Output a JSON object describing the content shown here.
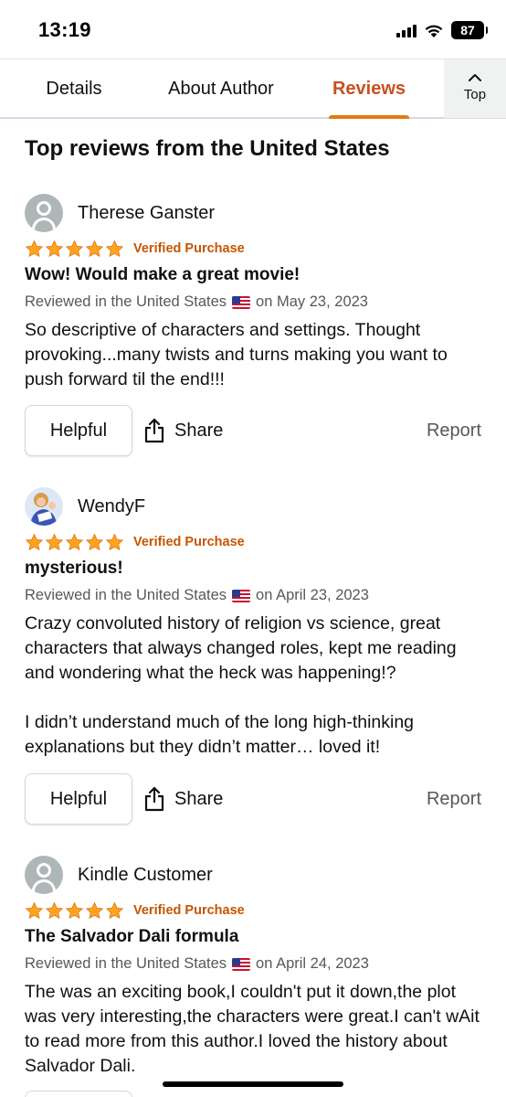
{
  "status_bar": {
    "time": "13:19",
    "battery": "87",
    "icons": [
      "signal-icon",
      "wifi-icon",
      "battery-icon"
    ]
  },
  "tabs": [
    {
      "label": "Details",
      "active": false
    },
    {
      "label": "About Author",
      "active": false
    },
    {
      "label": "Reviews",
      "active": true
    }
  ],
  "top_button": {
    "label": "Top",
    "icon": "chevron-up-icon"
  },
  "section_title": "Top reviews from the United States",
  "reviews": [
    {
      "name": "Therese Ganster",
      "rating": 5,
      "verified": "Verified Purchase",
      "title": "Wow! Would make a great movie!",
      "meta_prefix": "Reviewed in the United States",
      "meta_date": "on May 23, 2023",
      "body": [
        "So descriptive of characters and settings. Thought provoking...many twists and turns making you want to push forward til the end!!!"
      ],
      "helpful": "Helpful",
      "share": "Share",
      "report": "Report"
    },
    {
      "name": "WendyF",
      "rating": 5,
      "verified": "Verified Purchase",
      "title": "mysterious!",
      "meta_prefix": "Reviewed in the United States",
      "meta_date": "on April 23, 2023",
      "body": [
        "Crazy convoluted history of religion vs science, great characters that always changed roles, kept me reading and wondering what the heck was happening!?",
        "I didn’t understand much of the long high-thinking explanations but they didn’t matter… loved it!"
      ],
      "helpful": "Helpful",
      "share": "Share",
      "report": "Report"
    },
    {
      "name": "Kindle Customer",
      "rating": 5,
      "verified": "Verified Purchase",
      "title": "The Salvador Dali formula",
      "meta_prefix": "Reviewed in the United States",
      "meta_date": "on April 24, 2023",
      "body": [
        "The was an exciting book,I couldn't put it down,the plot was very interesting,the characters were great.I can't wAit to read more from this author.I loved the history about Salvador Dali."
      ]
    }
  ],
  "colors": {
    "accent": "#c7511f",
    "star": "#ffa41c",
    "verified": "#c45500",
    "muted": "#565959"
  }
}
